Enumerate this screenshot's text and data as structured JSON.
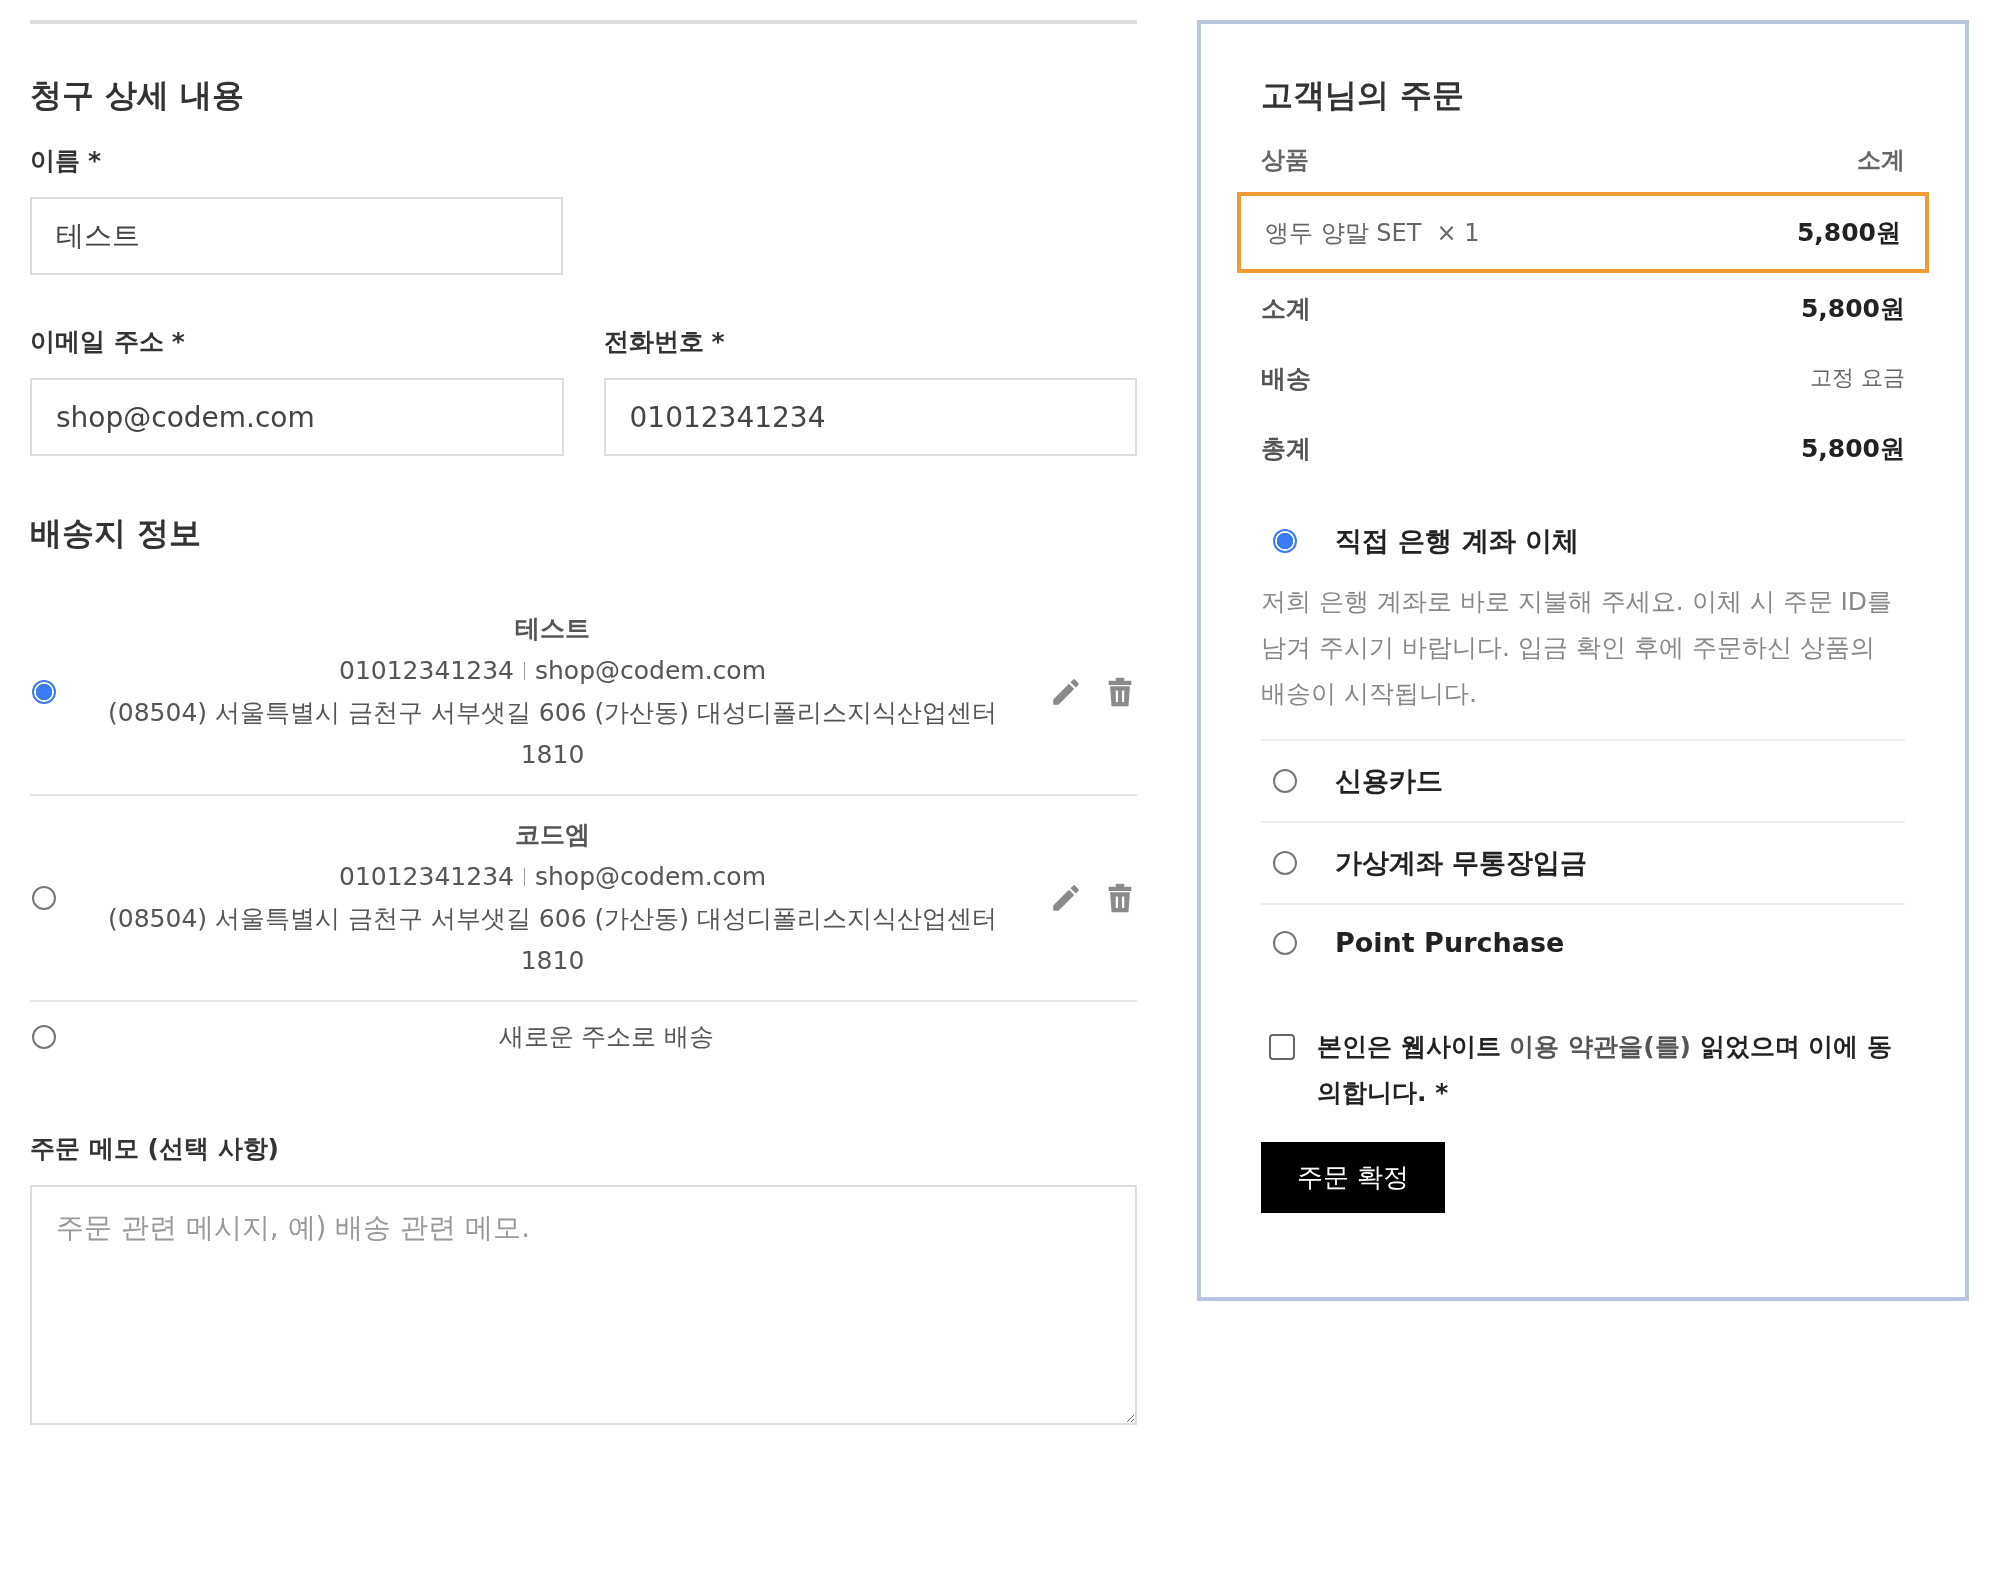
{
  "billing": {
    "title": "청구 상세 내용",
    "fields": [
      {
        "label": "이름",
        "required": true,
        "value": "테스트"
      },
      {
        "label": "이메일 주소",
        "required": true,
        "value": "shop@codem.com"
      },
      {
        "label": "전화번호",
        "required": true,
        "value": "01012341234"
      }
    ],
    "required_mark": "*"
  },
  "shipping": {
    "title": "배송지 정보",
    "addresses": [
      {
        "selected": true,
        "name": "테스트",
        "phone": "01012341234",
        "email": "shop@codem.com",
        "address": "(08504) 서울특별시 금천구 서부샛길 606 (가산동) 대성디폴리스지식산업센터 1810"
      },
      {
        "selected": false,
        "name": "코드엠",
        "phone": "01012341234",
        "email": "shop@codem.com",
        "address": "(08504) 서울특별시 금천구 서부샛길 606 (가산동) 대성디폴리스지식산업센터 1810"
      }
    ],
    "new_address": {
      "selected": false,
      "label": "새로운 주소로 배송"
    }
  },
  "memo": {
    "label": "주문 메모 (선택 사항)",
    "placeholder": "주문 관련 메시지, 예) 배송 관련 메모."
  },
  "order": {
    "title": "고객님의 주문",
    "columns": [
      "상품",
      "소계"
    ],
    "items": [
      {
        "name": "앵두 양말 SET",
        "quantity": "× 1",
        "price": "5,800원",
        "highlighted": true
      }
    ],
    "totals": [
      {
        "label": "소계",
        "value": "5,800원",
        "kind": "amount"
      },
      {
        "label": "배송",
        "value": "고정 요금",
        "kind": "note"
      },
      {
        "label": "총계",
        "value": "5,800원",
        "kind": "amount"
      }
    ],
    "payment_methods": [
      {
        "label": "직접 은행 계좌 이체",
        "selected": true,
        "description": "저희 은행 계좌로 바로 지불해 주세요. 이체 시 주문 ID를 남겨 주시기 바랍니다. 입금 확인 후에 주문하신 상품의 배송이 시작됩니다."
      },
      {
        "label": "신용카드",
        "selected": false
      },
      {
        "label": "가상계좌 무통장입금",
        "selected": false
      },
      {
        "label": "Point Purchase",
        "selected": false
      }
    ],
    "terms": {
      "checked": false,
      "before": "본인은 웹사이트 ",
      "link": "이용 약관을(를)",
      "after": " 읽었으며 이에 동의합니다. *"
    },
    "submit": "주문 확정"
  }
}
